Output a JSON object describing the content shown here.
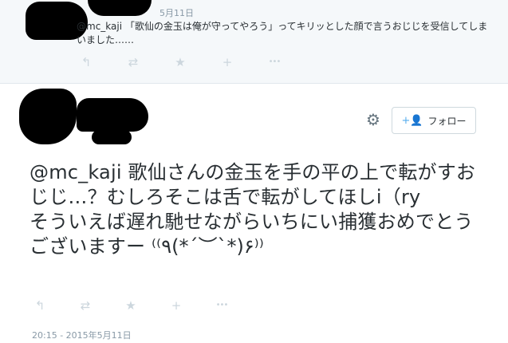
{
  "reply_tweet": {
    "date": "5月11日",
    "text": "@mc_kaji 「歌仙の金玉は俺が守ってやろう」ってキリッとした顔で言うおじじを受信してしまいました……",
    "actions": {
      "reply_icon": "↰",
      "retweet_icon": "⇄",
      "favorite_icon": "★",
      "follow_icon": "+",
      "more_icon": "•••"
    }
  },
  "main_tweet": {
    "follow_button": {
      "icon": "+👤",
      "label": "フォロー"
    },
    "gear_icon": "⚙",
    "text": "@mc_kaji 歌仙さんの金玉を手の平の上で転がすおじじ…？むしろそこは舌で転がしてほしi（ry\nそういえば遅れ馳せながらいちにい捕獲おめでとうございますー ⁽⁽٩(*´︶`*)۶⁾⁾",
    "actions": {
      "reply_icon": "↰",
      "retweet_icon": "⇄",
      "favorite_icon": "★",
      "follow_icon": "+",
      "more_icon": "•••"
    },
    "timestamp": "20:15 - 2015年5月11日"
  },
  "colors": {
    "reply_bg": "#f5f8fa",
    "text": "#292f33",
    "muted": "#8899a6",
    "icon": "#ccd6dd",
    "accent": "#55acee"
  }
}
